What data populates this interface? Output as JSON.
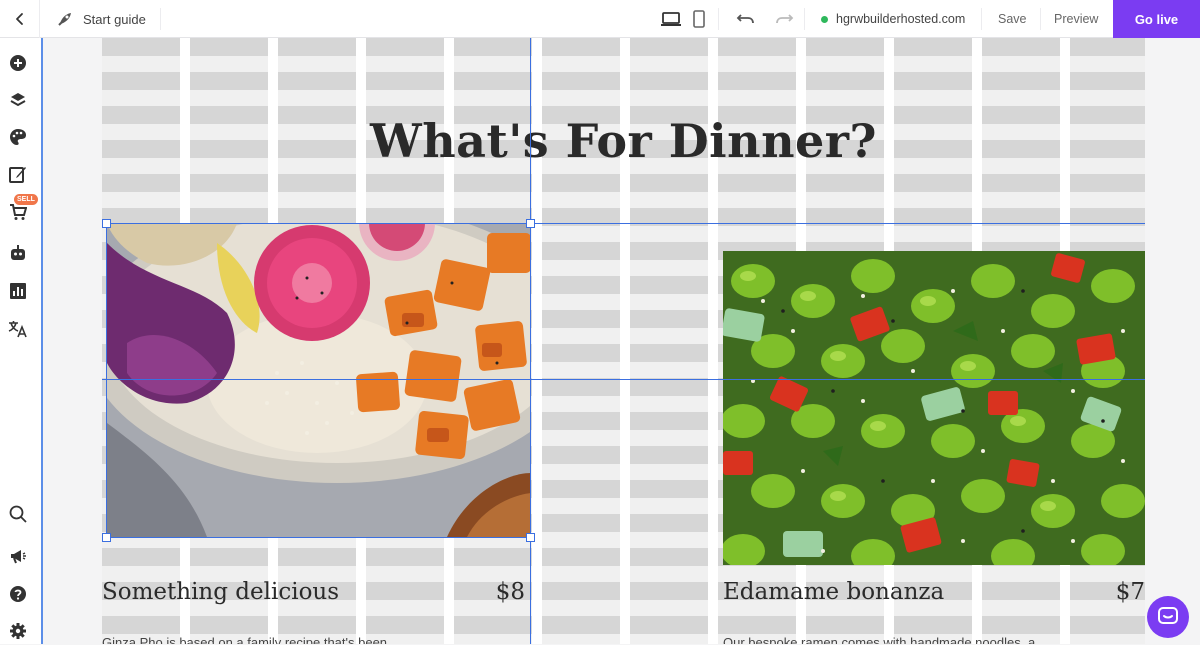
{
  "topbar": {
    "guide_label": "Start guide",
    "domain": "hgrwbuilderhosted.com",
    "save_label": "Save",
    "preview_label": "Preview",
    "golive_label": "Go live"
  },
  "sidebar": {
    "sell_badge": "SELL",
    "items": [
      "add-icon",
      "layers-icon",
      "palette-icon",
      "edit-icon",
      "cart-icon",
      "robot-icon",
      "chart-icon",
      "translate-icon",
      "search-icon",
      "megaphone-icon",
      "help-icon",
      "gear-icon"
    ]
  },
  "page": {
    "title": "What's For Dinner?",
    "items": [
      {
        "name": "Something delicious",
        "price": "$8",
        "desc": "Ginza Pho is based on a family recipe that's been"
      },
      {
        "name": "Edamame bonanza",
        "price": "$7",
        "desc": "Our bespoke ramen comes with handmade noodles, a"
      }
    ]
  },
  "colors": {
    "accent": "#7b3cf2",
    "selection": "#3b6fe0",
    "live_dot": "#2eb85c"
  }
}
